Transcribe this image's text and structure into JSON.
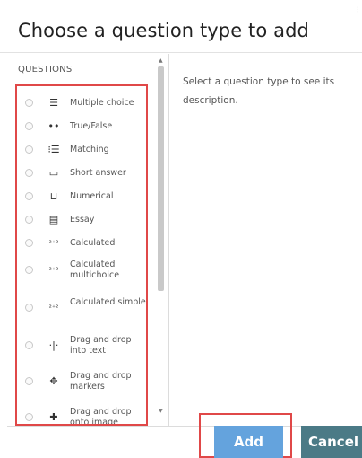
{
  "modal": {
    "title": "Choose a question type to add"
  },
  "left_panel": {
    "header": "QUESTIONS",
    "items": [
      {
        "label": "Multiple choice",
        "icon": "list-icon",
        "glyph": "☰"
      },
      {
        "label": "True/False",
        "icon": "two-dots-icon",
        "glyph": "••"
      },
      {
        "label": "Matching",
        "icon": "grid-list-icon",
        "glyph": "⁝☰"
      },
      {
        "label": "Short answer",
        "icon": "input-box-icon",
        "glyph": "▭"
      },
      {
        "label": "Numerical",
        "icon": "numeric-icon",
        "glyph": "⊔"
      },
      {
        "label": "Essay",
        "icon": "document-icon",
        "glyph": "▤"
      },
      {
        "label": "Calculated",
        "icon": "calculated-icon",
        "glyph": "²⁺²"
      },
      {
        "label": "Calculated multichoice",
        "icon": "calculated-multichoice-icon",
        "glyph": "²⁺²"
      },
      {
        "label": "Calculated simple",
        "icon": "calculated-simple-icon",
        "glyph": "²⁺²"
      },
      {
        "label": "Drag and drop into text",
        "icon": "drag-vertical-icon",
        "glyph": "·|·"
      },
      {
        "label": "Drag and drop markers",
        "icon": "drag-markers-icon",
        "glyph": "✥"
      },
      {
        "label": "Drag and drop onto image",
        "icon": "drag-move-icon",
        "glyph": "✚"
      }
    ]
  },
  "right_panel": {
    "description": "Select a question type to see its description."
  },
  "footer": {
    "add_label": "Add",
    "cancel_label": "Cancel"
  },
  "colors": {
    "highlight": "#e04848",
    "add_button": "#64a3dd",
    "cancel_button": "#4b7a86"
  }
}
